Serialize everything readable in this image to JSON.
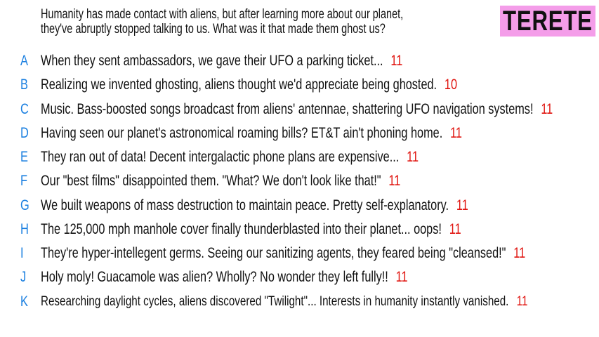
{
  "prompt": {
    "line1": "Humanity has made contact with aliens, but after learning more about our planet,",
    "line2": "they've abruptly stopped talking to us. What was it that made them ghost us?"
  },
  "player_badge": {
    "name": "TERETE",
    "color": "#f49de9"
  },
  "colors": {
    "letter": "#1a7fe0",
    "score": "#e0140f"
  },
  "answers": [
    {
      "letter": "A",
      "text": "When they sent ambassadors, we gave their UFO a parking ticket...",
      "score": "11"
    },
    {
      "letter": "B",
      "text": "Realizing we invented ghosting, aliens thought we'd appreciate being ghosted.",
      "score": "10"
    },
    {
      "letter": "C",
      "text": "Music. Bass-boosted songs broadcast from aliens' antennae, shattering UFO navigation systems!",
      "score": "11"
    },
    {
      "letter": "D",
      "text": "Having seen our planet's astronomical roaming bills? ET&T ain't phoning home.",
      "score": "11"
    },
    {
      "letter": "E",
      "text": "They ran out of data! Decent intergalactic phone plans are expensive...",
      "score": "11"
    },
    {
      "letter": "F",
      "text": "Our \"best films\" disappointed them. \"What? We don't look like that!\"",
      "score": "11"
    },
    {
      "letter": "G",
      "text": "We built weapons of mass destruction to maintain peace. Pretty self-explanatory.",
      "score": "11"
    },
    {
      "letter": "H",
      "text": "The 125,000 mph manhole cover finally thunderblasted into their planet... oops!",
      "score": "11"
    },
    {
      "letter": "I",
      "text": "They're hyper-intellegent germs. Seeing our sanitizing agents, they feared being \"cleansed!\"",
      "score": "11"
    },
    {
      "letter": "J",
      "text": "Holy moly! Guacamole was alien? Wholly? No wonder they left fully!!",
      "score": "11"
    },
    {
      "letter": "K",
      "text": "Researching daylight cycles, aliens discovered \"Twilight\"... Interests in humanity instantly vanished.",
      "score": "11"
    }
  ]
}
